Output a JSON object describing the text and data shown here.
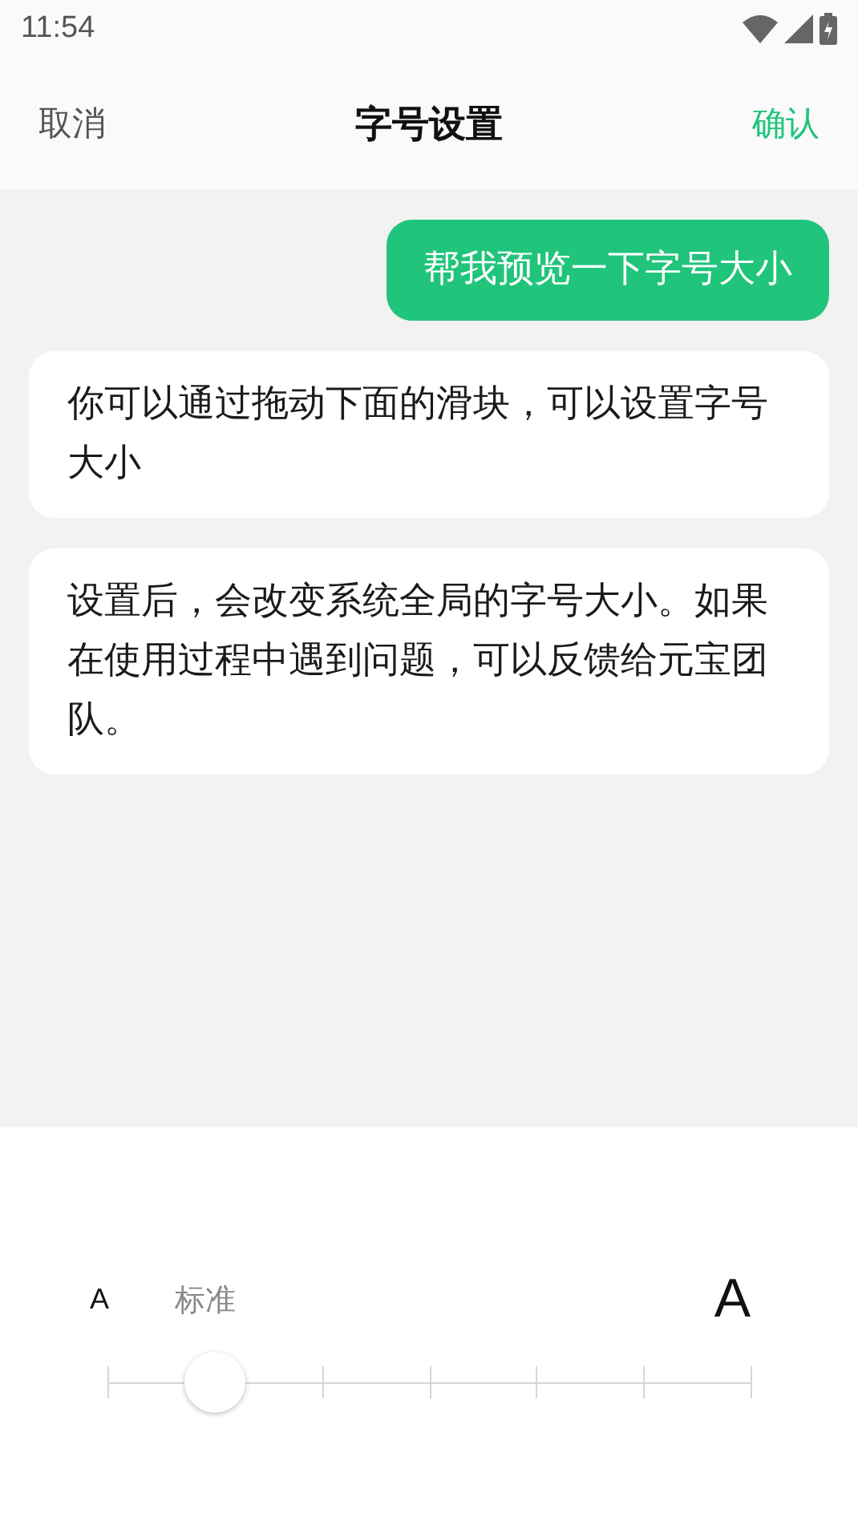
{
  "status_bar": {
    "time": "11:54"
  },
  "header": {
    "cancel": "取消",
    "title": "字号设置",
    "confirm": "确认"
  },
  "messages": [
    {
      "kind": "user",
      "text": "帮我预览一下字号大小"
    },
    {
      "kind": "bot",
      "text": "你可以通过拖动下面的滑块，可以设置字号大小"
    },
    {
      "kind": "bot",
      "text": "设置后，会改变系统全局的字号大小。如果在使用过程中遇到问题，可以反馈给元宝团队。"
    }
  ],
  "font_size": {
    "small_label": "A",
    "current": "标准",
    "large_label": "A",
    "level": 0.1667
  }
}
